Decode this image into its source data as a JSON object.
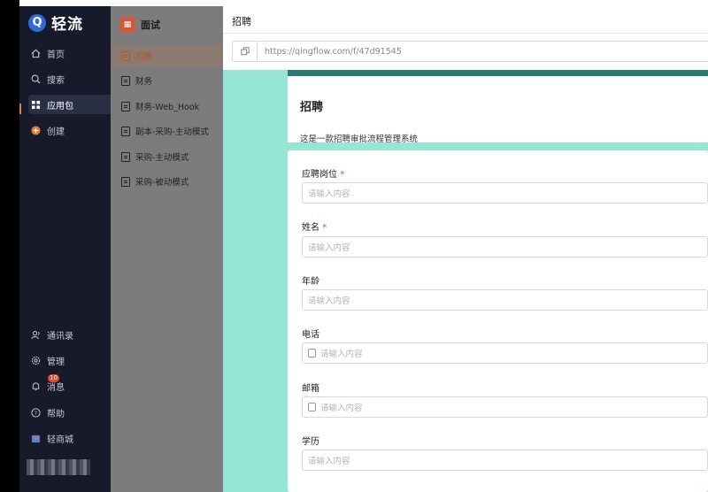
{
  "brand": {
    "logo_letter": "Q",
    "name": "轻流"
  },
  "nav": {
    "top_items": [
      {
        "label": "首页",
        "icon": "home-icon"
      },
      {
        "label": "搜索",
        "icon": "search-icon"
      },
      {
        "label": "应用包",
        "icon": "grid-icon"
      },
      {
        "label": "创建",
        "icon": "plus-circle-icon"
      }
    ],
    "bottom_items": [
      {
        "label": "通讯录",
        "icon": "contacts-icon"
      },
      {
        "label": "管理",
        "icon": "gear-icon"
      },
      {
        "label": "消息",
        "icon": "bell-icon",
        "badge": "10"
      },
      {
        "label": "帮助",
        "icon": "help-icon"
      },
      {
        "label": "轻商城",
        "icon": "store-icon"
      }
    ]
  },
  "apps": {
    "title": "面试",
    "items": [
      {
        "label": "招聘"
      },
      {
        "label": "财务"
      },
      {
        "label": "财务-Web_Hook"
      },
      {
        "label": "副本-采购-主动模式"
      },
      {
        "label": "采购-主动模式"
      },
      {
        "label": "采购-被动模式"
      }
    ]
  },
  "main": {
    "title": "招聘",
    "url": "https://qingflow.com/f/47d91545"
  },
  "form": {
    "title": "招聘",
    "description": "这是一款招聘审批流程管理系统",
    "fields": [
      {
        "label": "应聘岗位",
        "required": "*",
        "placeholder": "请输入内容"
      },
      {
        "label": "姓名",
        "required": "*",
        "placeholder": "请输入内容"
      },
      {
        "label": "年龄",
        "required": "",
        "placeholder": "请输入内容"
      },
      {
        "label": "电话",
        "required": "",
        "placeholder": "请输入内容"
      },
      {
        "label": "邮箱",
        "required": "",
        "placeholder": "请输入内容"
      },
      {
        "label": "学历",
        "required": "",
        "placeholder": "请输入内容"
      }
    ]
  },
  "colors": {
    "accent": "#2a7a72",
    "preview_bg": "#96e6d5",
    "nav_bg": "#161a2b",
    "active_text": "#b7552c"
  }
}
